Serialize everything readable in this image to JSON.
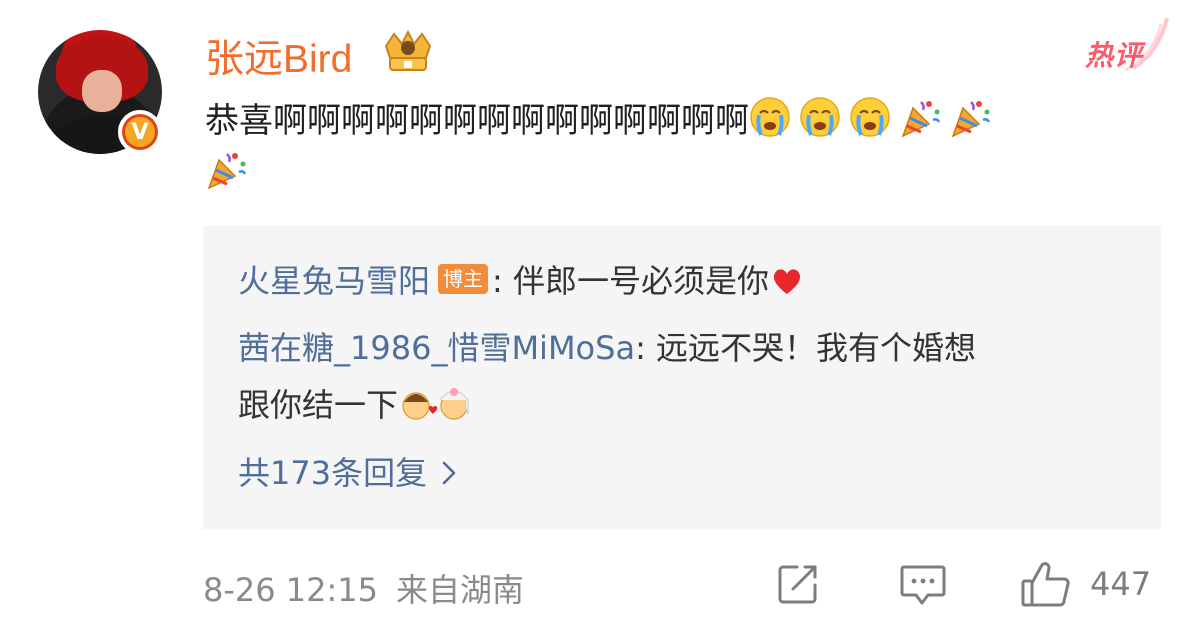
{
  "comment": {
    "username": "张远Bird",
    "hot_label": "热评",
    "text_main": "恭喜啊啊啊啊啊啊啊啊啊啊啊啊啊啊",
    "emoji_row": [
      "crying-face",
      "crying-face",
      "crying-face",
      "party-popper",
      "party-popper",
      "party-popper"
    ],
    "verified_badge": "V"
  },
  "replies": [
    {
      "nick": "火星兔马雪阳",
      "badge": "博主",
      "separator": ": ",
      "text": "伴郎一号必须是你"
    },
    {
      "nick": "茜在糖_1986_惜雪MiMoSa",
      "separator": ": ",
      "text_line1": "远远不哭！我有个婚想",
      "text_line2": "跟你结一下"
    }
  ],
  "more_replies_label": "共173条回复",
  "footer": {
    "timestamp": "8-26 12:15",
    "location": "来自湖南",
    "like_count": "447"
  },
  "colors": {
    "username": "#f26d2a",
    "nick": "#4f6e99",
    "hot": "#ff5a6a",
    "reply_bg": "#f5f5f5",
    "meta": "#8a8a8a"
  }
}
